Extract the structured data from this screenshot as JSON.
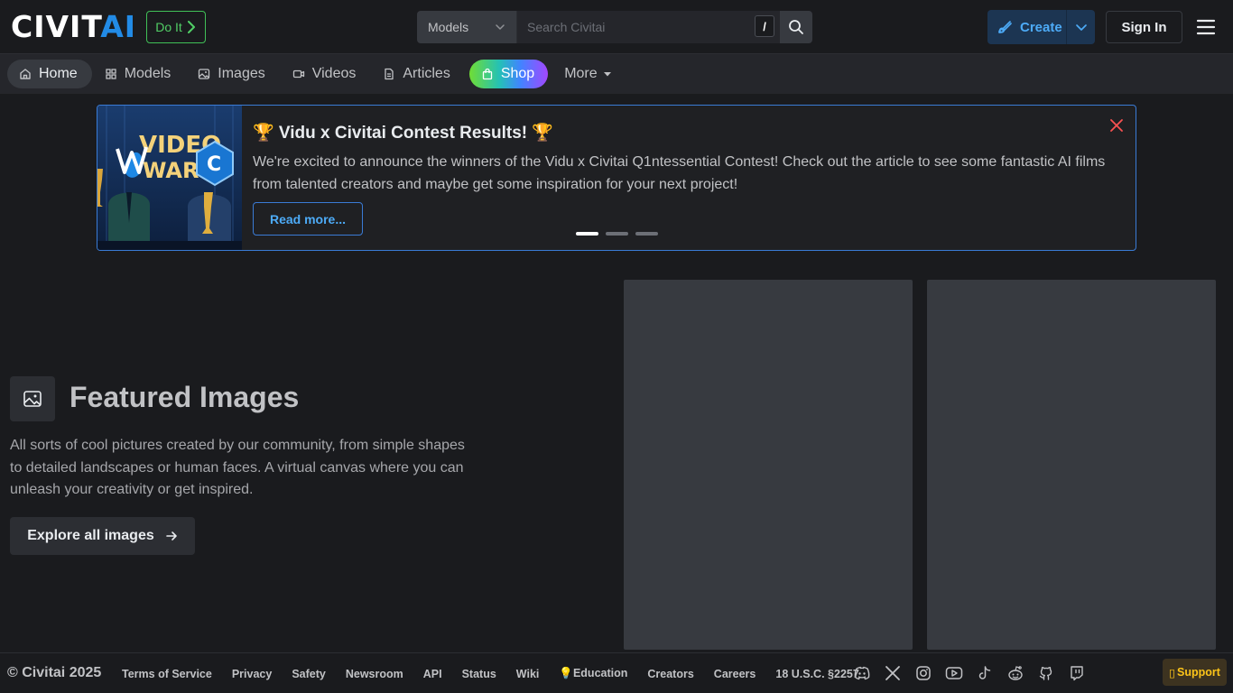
{
  "header": {
    "logo_text_a": "CIVIT",
    "logo_text_b": "AI",
    "doit_label": "Do It",
    "search_type": "Models",
    "search_placeholder": "Search Civitai",
    "search_shortcut": "/",
    "create_label": "Create",
    "signin_label": "Sign In"
  },
  "nav": {
    "items": [
      {
        "label": "Home",
        "icon": "home-icon"
      },
      {
        "label": "Models",
        "icon": "grid-icon"
      },
      {
        "label": "Images",
        "icon": "image-icon"
      },
      {
        "label": "Videos",
        "icon": "video-icon"
      },
      {
        "label": "Articles",
        "icon": "file-icon"
      },
      {
        "label": "Shop",
        "icon": "shopping-bag-icon"
      },
      {
        "label": "More",
        "icon": "caret-down-icon"
      }
    ]
  },
  "banner": {
    "title": "🏆 Vidu x Civitai Contest Results! 🏆",
    "text": "We're excited to announce the winners of the Vidu x Civitai Q1ntessential Contest! Check out the article to see some fantastic AI films from talented creators and maybe get some inspiration for your next project!",
    "button_label": "Read more...",
    "slide_active": 1,
    "slide_count": 3
  },
  "featured": {
    "title": "Featured Images",
    "description": "All sorts of cool pictures created by our community, from simple shapes to detailed landscapes or human faces. A virtual canvas where you can unleash your creativity or get inspired.",
    "button_label": "Explore all images"
  },
  "footer": {
    "copyright": "© Civitai 2025",
    "links": [
      "Terms of Service",
      "Privacy",
      "Safety",
      "Newsroom",
      "API",
      "Status",
      "Wiki",
      "💡Education",
      "Creators",
      "Careers",
      "18 U.S.C. §2257"
    ],
    "socials": [
      "discord-icon",
      "x-icon",
      "instagram-icon",
      "youtube-icon",
      "tiktok-icon",
      "reddit-icon",
      "github-icon",
      "twitch-icon"
    ],
    "support_label": "Support"
  },
  "colors": {
    "background": "#1a1b1e",
    "nav_bg": "#25262b",
    "accent_blue": "#228be6",
    "doit_green": "#40c057",
    "support_yellow": "#fcc419"
  }
}
